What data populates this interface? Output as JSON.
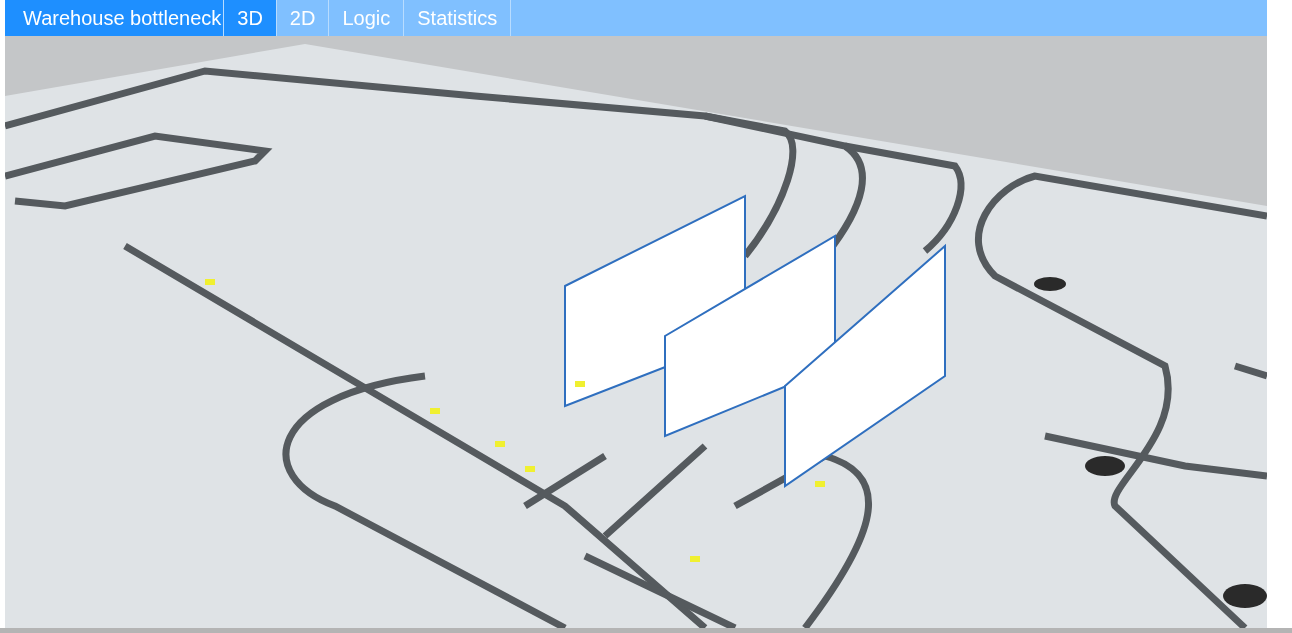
{
  "app_title": "Warehouse bottleneck",
  "tabs": [
    {
      "label": "3D",
      "selected": true
    },
    {
      "label": "2D",
      "selected": false
    },
    {
      "label": "Logic",
      "selected": false
    },
    {
      "label": "Statistics",
      "selected": false
    }
  ]
}
